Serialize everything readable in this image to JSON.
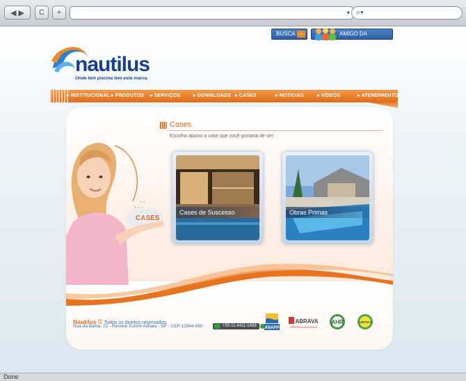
{
  "browser": {
    "back_fwd": "◀ ▶",
    "reload": "C",
    "new_tab": "+",
    "url": "",
    "search_glyph": "⌕▾",
    "status": "Done"
  },
  "header": {
    "busca_label": "BUSCA",
    "amigo_label": "AMIGO DA REVENDA",
    "logo_name": "nautilus",
    "logo_tagline": "Onde tem piscina tem esta marca."
  },
  "nav": {
    "items": [
      {
        "label": "INSTITUCIONAL"
      },
      {
        "label": "PRODUTOS"
      },
      {
        "label": "SERVIÇOS"
      },
      {
        "label": "DOWNLOADS"
      },
      {
        "label": "CASES"
      },
      {
        "label": "NOTÍCIAS"
      },
      {
        "label": "VÍDEOS"
      },
      {
        "label": "ATENDIMENTO"
      }
    ]
  },
  "main": {
    "hero_badge": "CASES",
    "title": "Cases",
    "subtitle": "Escolha abaixo a case que você gostaria de ver:",
    "cases": [
      {
        "label": "Cases de Suscesso"
      },
      {
        "label": "Obras Primas"
      }
    ]
  },
  "footer": {
    "brand": "Nautilus",
    "copyright_symbol": "©",
    "rights": "Todos os direitos reservados.",
    "address": "Rua da Bahia, 22 - Recreio Estoril-Atibaia - SP - CEP 12944-060",
    "phone": "+55-11-4411-1488",
    "partners": {
      "anapp": "ANAPP",
      "abrava": "ABRAVA",
      "abrava_sub": "EMPRESA ASSOCIADA",
      "ahr": "AHR",
      "abesco": "ABESCO"
    }
  },
  "colors": {
    "accent_orange": "#e26b17",
    "brand_blue": "#1a3f8e",
    "link_blue": "#3070b8"
  }
}
